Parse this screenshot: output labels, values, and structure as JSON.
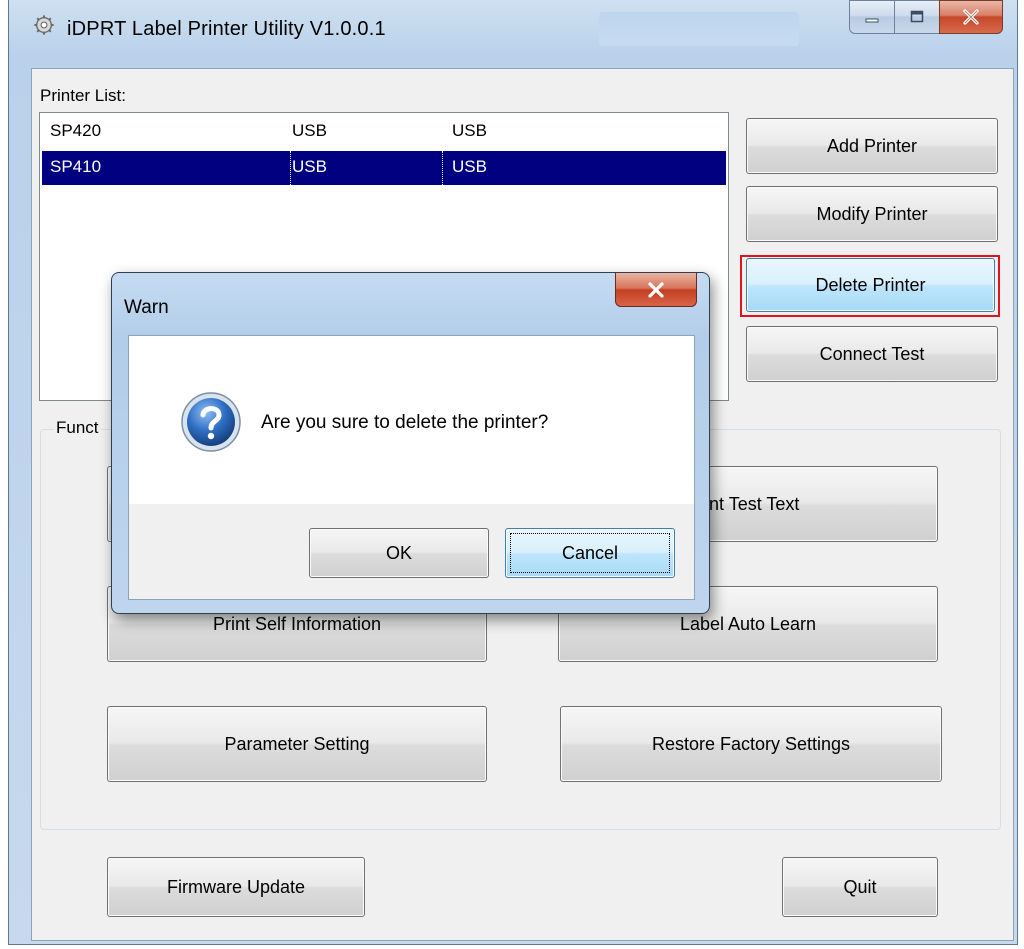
{
  "window": {
    "title": "iDPRT Label Printer Utility  V1.0.0.1",
    "icon": "gear-icon",
    "caption_buttons": [
      "minimize-icon",
      "maximize-icon",
      "close-icon"
    ]
  },
  "printer_list": {
    "label": "Printer List:",
    "rows": [
      {
        "name": "SP420",
        "port": "USB",
        "type": "USB",
        "selected": false
      },
      {
        "name": "SP410",
        "port": "USB",
        "type": "USB",
        "selected": true
      }
    ]
  },
  "side_buttons": {
    "add": "Add Printer",
    "modify": "Modify Printer",
    "delete": "Delete Printer",
    "connect_test": "Connect Test"
  },
  "function_group": {
    "label": "Funct",
    "buttons": {
      "print_test_text": "nt Test Text",
      "print_self_info": "Print Self Information",
      "label_auto_learn": "Label Auto Learn",
      "parameter_setting": "Parameter Setting",
      "restore_factory": "Restore Factory Settings"
    }
  },
  "bottom_buttons": {
    "firmware_update": "Firmware Update",
    "quit": "Quit"
  },
  "dialog": {
    "title": "Warn",
    "icon": "question-icon",
    "message": "Are you sure to delete the printer?",
    "ok": "OK",
    "cancel": "Cancel"
  },
  "colors": {
    "selection": "#000080",
    "highlight_box": "#e0141e"
  }
}
